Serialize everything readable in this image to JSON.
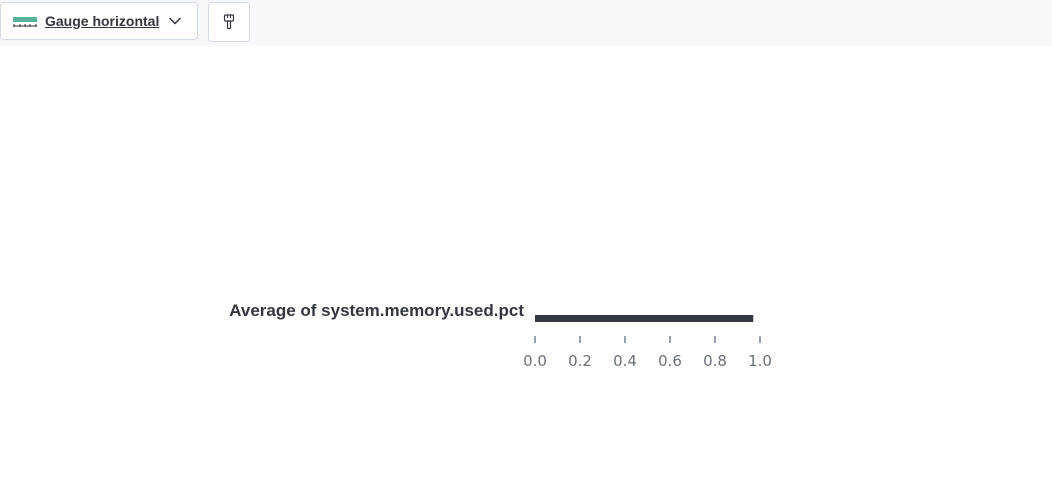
{
  "toolbar": {
    "chart_type_label": "Gauge horizontal",
    "chart_type_icon": "gauge-horizontal-icon",
    "chart_type_menu_icon": "chevron-down-icon",
    "style_button_icon": "paintbrush-icon"
  },
  "colors": {
    "accent": "#54b399",
    "text": "#343741",
    "tick": "#69707d",
    "bar": "#343741"
  },
  "chart_data": {
    "type": "gauge",
    "title": "Average of system.memory.used.pct",
    "value": 0.97,
    "min": 0,
    "max": 1,
    "ticks": [
      "0.0",
      "0.2",
      "0.4",
      "0.6",
      "0.8",
      "1.0"
    ]
  }
}
